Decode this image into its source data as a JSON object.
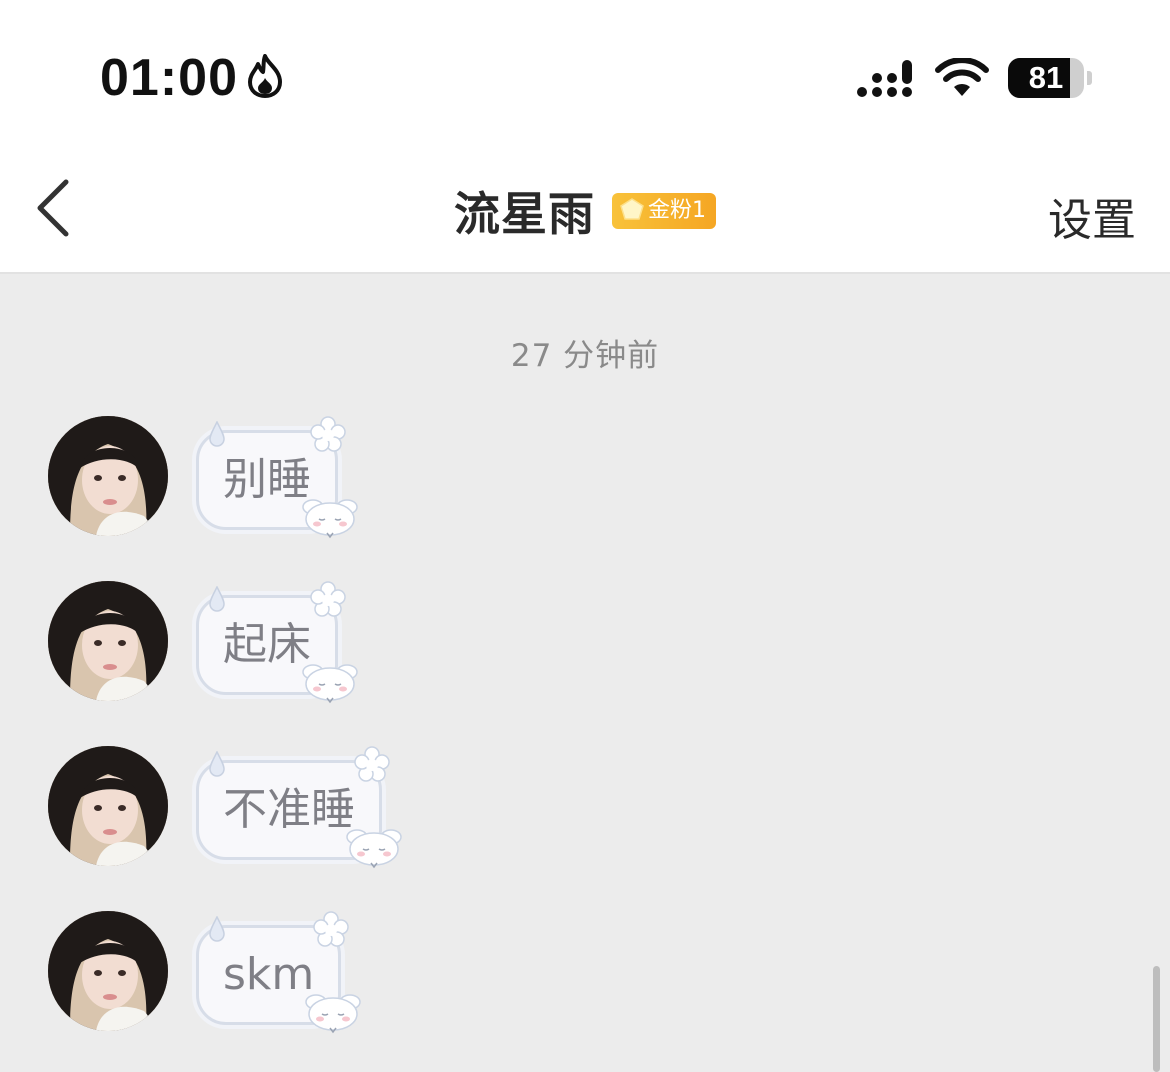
{
  "status_bar": {
    "time": "01:00",
    "battery_percent": 81,
    "battery_label": "81"
  },
  "nav": {
    "title": "流星雨",
    "badge": "金粉1",
    "settings_label": "设置"
  },
  "timestamp": "27 分钟前",
  "messages": [
    {
      "text": "别睡"
    },
    {
      "text": "起床"
    },
    {
      "text": "不准睡"
    },
    {
      "text": "skm"
    }
  ],
  "colors": {
    "background": "#ececec",
    "badge": "#f5a623",
    "bubble_border": "#d7dde8"
  }
}
